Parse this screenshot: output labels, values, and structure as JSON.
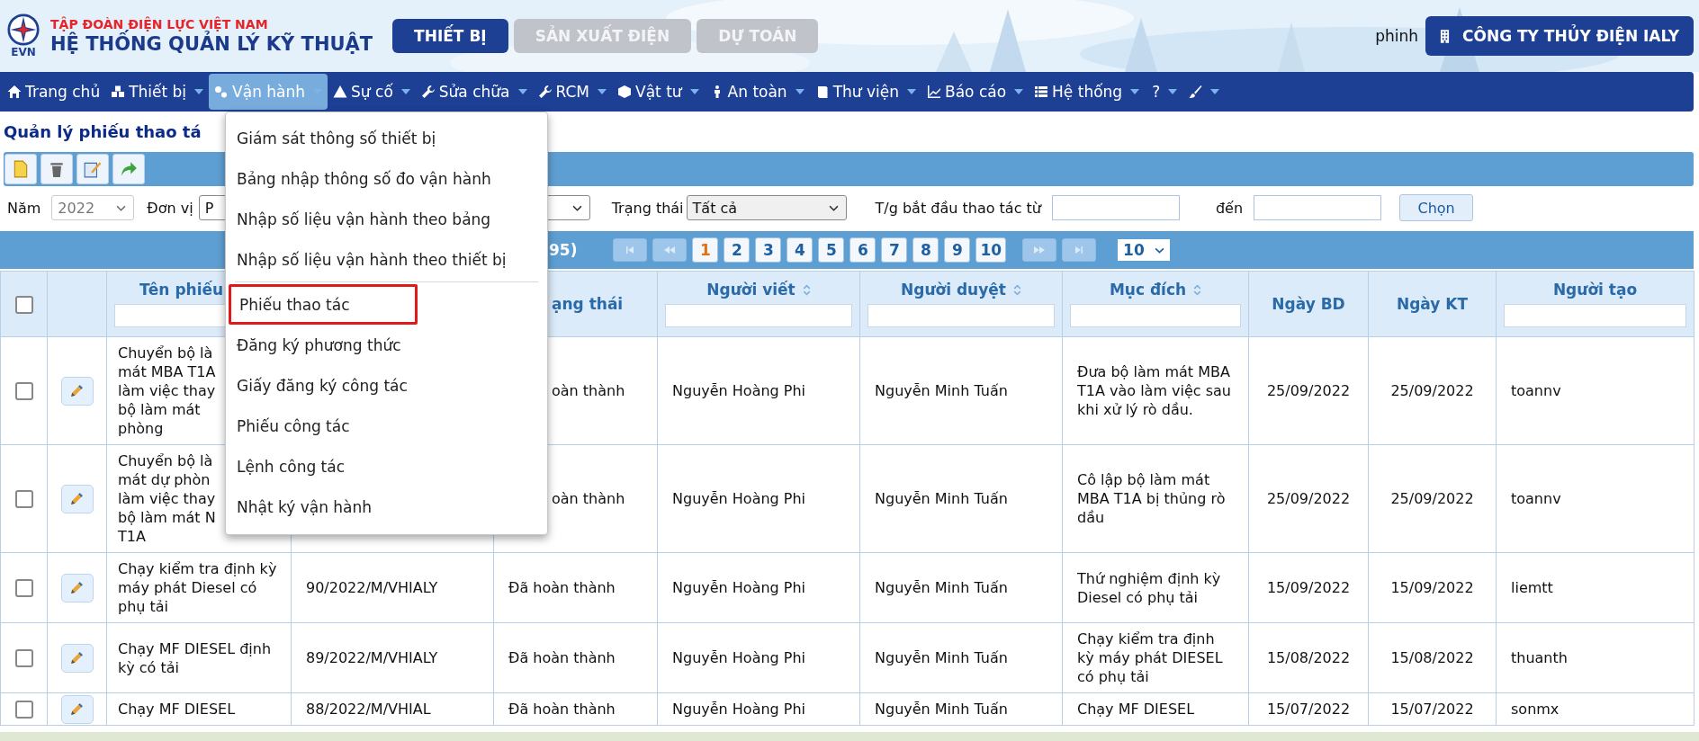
{
  "header": {
    "logo_text": "EVN",
    "org": "TẬP ĐOÀN ĐIỆN LỰC VIỆT NAM",
    "system": "HỆ THỐNG QUẢN LÝ KỸ THUẬT",
    "modules": [
      {
        "label": "THIẾT BỊ",
        "selected": true
      },
      {
        "label": "SẢN XUẤT ĐIỆN",
        "selected": false
      },
      {
        "label": "DỰ TOÁN",
        "selected": false
      }
    ],
    "user": "phinh",
    "company": "CÔNG TY THỦY ĐIỆN IALY"
  },
  "nav": [
    {
      "label": "Trang chủ",
      "has_menu": false,
      "selected": false
    },
    {
      "label": "Thiết bị",
      "has_menu": true,
      "selected": false
    },
    {
      "label": "Vận hành",
      "has_menu": true,
      "selected": true
    },
    {
      "label": "Sự cố",
      "has_menu": true,
      "selected": false
    },
    {
      "label": "Sửa chữa",
      "has_menu": true,
      "selected": false
    },
    {
      "label": "RCM",
      "has_menu": true,
      "selected": false
    },
    {
      "label": "Vật tư",
      "has_menu": true,
      "selected": false
    },
    {
      "label": "An toàn",
      "has_menu": true,
      "selected": false
    },
    {
      "label": "Thư viện",
      "has_menu": true,
      "selected": false
    },
    {
      "label": "Báo cáo",
      "has_menu": true,
      "selected": false
    },
    {
      "label": "Hệ thống",
      "has_menu": true,
      "selected": false
    },
    {
      "label": "?",
      "has_menu": true,
      "selected": false
    },
    {
      "has_menu": true,
      "selected": false
    }
  ],
  "page_title": "Quản lý phiếu thao tá",
  "filters": {
    "year_label": "Năm",
    "year": "2022",
    "unit_label": "Đơn vị",
    "unit": "P",
    "status_label": "Trạng thái",
    "status": "Tất cả",
    "start_label": "T/g bắt đầu thao tác từ",
    "to_label": "đến",
    "apply": "Chọn"
  },
  "pager": {
    "total": "95)",
    "pages": [
      {
        "label": "1",
        "selected": true
      },
      {
        "label": "2",
        "selected": false
      },
      {
        "label": "3",
        "selected": false
      },
      {
        "label": "4",
        "selected": false
      },
      {
        "label": "5",
        "selected": false
      },
      {
        "label": "6",
        "selected": false
      },
      {
        "label": "7",
        "selected": false
      },
      {
        "label": "8",
        "selected": false
      },
      {
        "label": "9",
        "selected": false
      },
      {
        "label": "10",
        "selected": false
      }
    ],
    "page_size": "10"
  },
  "table": {
    "select_all": {
      "checked": false
    },
    "columns": {
      "name": {
        "label": "Tên phiếu",
        "filter": true
      },
      "status": {
        "label": "ạng thái",
        "sortable": false,
        "filter": false
      },
      "writer": {
        "label": "Người viết",
        "sortable": true,
        "filter": true
      },
      "approver": {
        "label": "Người duyệt",
        "sortable": true,
        "filter": true
      },
      "purpose": {
        "label": "Mục đích",
        "sortable": true,
        "filter": true
      },
      "start": {
        "label": "Ngày BD",
        "sortable": false,
        "filter": false
      },
      "end": {
        "label": "Ngày KT",
        "sortable": false,
        "filter": false
      },
      "creator": {
        "label": "Người tạo",
        "sortable": false,
        "filter": true
      }
    },
    "rows": [
      {
        "checked": false,
        "name": "Chuyển bộ là\nmát MBA T1A\nlàm việc thay\nbộ làm mát\nphòng",
        "status": "oàn thành",
        "writer": "Nguyễn Hoàng Phi",
        "approver": "Nguyễn Minh Tuấn",
        "purpose": "Đưa bộ làm mát MBA T1A vào làm việc sau khi xử lý rò dầu.",
        "start": "25/09/2022",
        "end": "25/09/2022",
        "creator": "toannv"
      },
      {
        "checked": false,
        "name": "Chuyển bộ là\nmát dự phòn\nlàm việc thay\nbộ làm mát N\nT1A",
        "status": "oàn thành",
        "writer": "Nguyễn Hoàng Phi",
        "approver": "Nguyễn Minh Tuấn",
        "purpose": "Cô lập bộ làm mát MBA T1A bị thủng rò dầu",
        "start": "25/09/2022",
        "end": "25/09/2022",
        "creator": "toannv"
      },
      {
        "checked": false,
        "name": "Chạy kiểm tra định kỳ máy phát Diesel có phụ tải",
        "code": "90/2022/M/VHIALY",
        "status": "Đã hoàn thành",
        "writer": "Nguyễn Hoàng Phi",
        "approver": "Nguyễn Minh Tuấn",
        "purpose": "Thứ nghiệm định kỳ Diesel có phụ tải",
        "start": "15/09/2022",
        "end": "15/09/2022",
        "creator": "liemtt"
      },
      {
        "checked": false,
        "name": "Chạy MF DIESEL định kỳ có tải",
        "code": "89/2022/M/VHIALY",
        "status": "Đã hoàn thành",
        "writer": "Nguyễn Hoàng Phi",
        "approver": "Nguyễn Minh Tuấn",
        "purpose": "Chạy kiểm tra định kỳ máy phát DIESEL có phụ tải",
        "start": "15/08/2022",
        "end": "15/08/2022",
        "creator": "thuanth"
      },
      {
        "checked": false,
        "name": "Chạy MF DIESEL",
        "code": "88/2022/M/VHIAL",
        "status": "Đã hoàn thành",
        "writer": "Nguyễn Hoàng Phi",
        "approver": "Nguyễn Minh Tuấn",
        "purpose": "Chạy MF DIESEL",
        "start": "15/07/2022",
        "end": "15/07/2022",
        "creator": "sonmx"
      }
    ]
  },
  "menu": {
    "items": [
      {
        "kind": "item",
        "label": "Giám sát thông số thiết bị",
        "highlighted": false
      },
      {
        "kind": "item",
        "label": "Bảng nhập thông số đo vận hành",
        "highlighted": false
      },
      {
        "kind": "item",
        "label": "Nhập số liệu vận hành theo bảng",
        "highlighted": false
      },
      {
        "kind": "item",
        "label": "Nhập số liệu vận hành theo thiết bị",
        "highlighted": false
      },
      {
        "kind": "divider"
      },
      {
        "kind": "item",
        "label": "Phiếu thao tác",
        "highlighted": true
      },
      {
        "kind": "item",
        "label": "Đăng ký phương thức",
        "highlighted": false
      },
      {
        "kind": "item",
        "label": "Giấy đăng ký công tác",
        "highlighted": false
      },
      {
        "kind": "item",
        "label": "Phiếu công tác",
        "highlighted": false
      },
      {
        "kind": "item",
        "label": "Lệnh công tác",
        "highlighted": false
      },
      {
        "kind": "item",
        "label": "Nhật ký vận hành",
        "highlighted": false
      }
    ]
  }
}
